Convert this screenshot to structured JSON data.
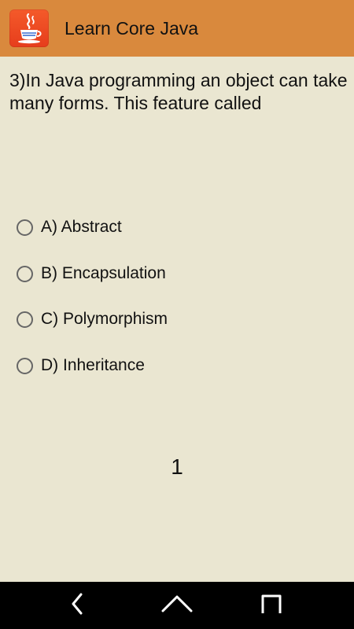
{
  "app_bar": {
    "title": "Learn Core Java",
    "icon": "java-coffee-cup-icon",
    "color": "#d9893d"
  },
  "quiz": {
    "question": "3)In Java programming an object can take many forms. This feature called",
    "options": [
      {
        "label": "A) Abstract",
        "selected": false
      },
      {
        "label": "B) Encapsulation",
        "selected": false
      },
      {
        "label": "C) Polymorphism",
        "selected": false
      },
      {
        "label": "D) Inheritance",
        "selected": false
      }
    ],
    "counter": "1"
  },
  "system_nav": {
    "back": "back-icon",
    "home": "home-icon",
    "recents": "recents-icon"
  },
  "colors": {
    "background": "#eae6d1",
    "app_bar": "#d9893d",
    "icon_bg": "#e63d1c",
    "nav_bar": "#000000"
  }
}
